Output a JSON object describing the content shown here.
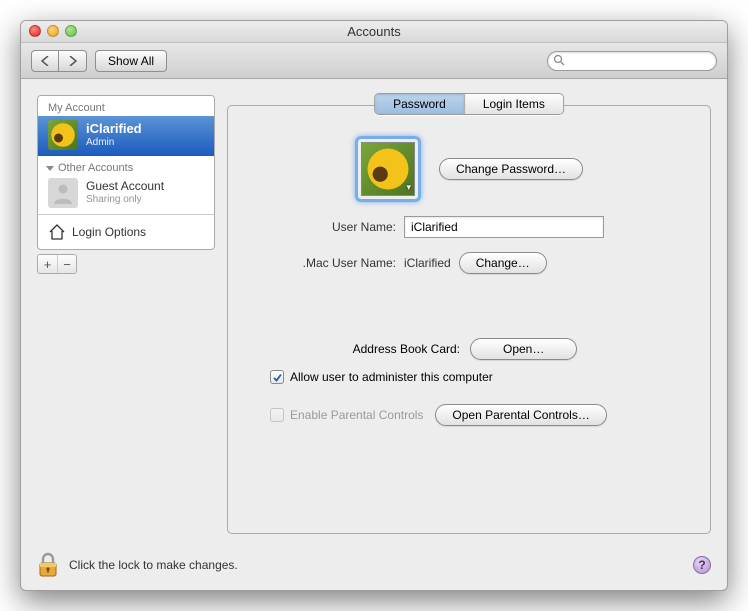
{
  "window": {
    "title": "Accounts"
  },
  "toolbar": {
    "showall_label": "Show All",
    "search_placeholder": ""
  },
  "sidebar": {
    "my_account_label": "My Account",
    "other_accounts_label": "Other Accounts",
    "selected": {
      "name": "iClarified",
      "role": "Admin"
    },
    "guest": {
      "name": "Guest Account",
      "role": "Sharing only"
    },
    "login_options_label": "Login Options"
  },
  "tabs": {
    "password": "Password",
    "login_items": "Login Items"
  },
  "main": {
    "change_password": "Change Password…",
    "username_label": "User Name:",
    "username_value": "iClarified",
    "mac_label": ".Mac User Name:",
    "mac_value": "iClarified",
    "change": "Change…",
    "addr_label": "Address Book Card:",
    "open": "Open…",
    "admin_label": "Allow user to administer this computer",
    "parental_label": "Enable Parental Controls",
    "open_parental": "Open Parental Controls…"
  },
  "footer": {
    "lock_text": "Click the lock to make changes."
  }
}
